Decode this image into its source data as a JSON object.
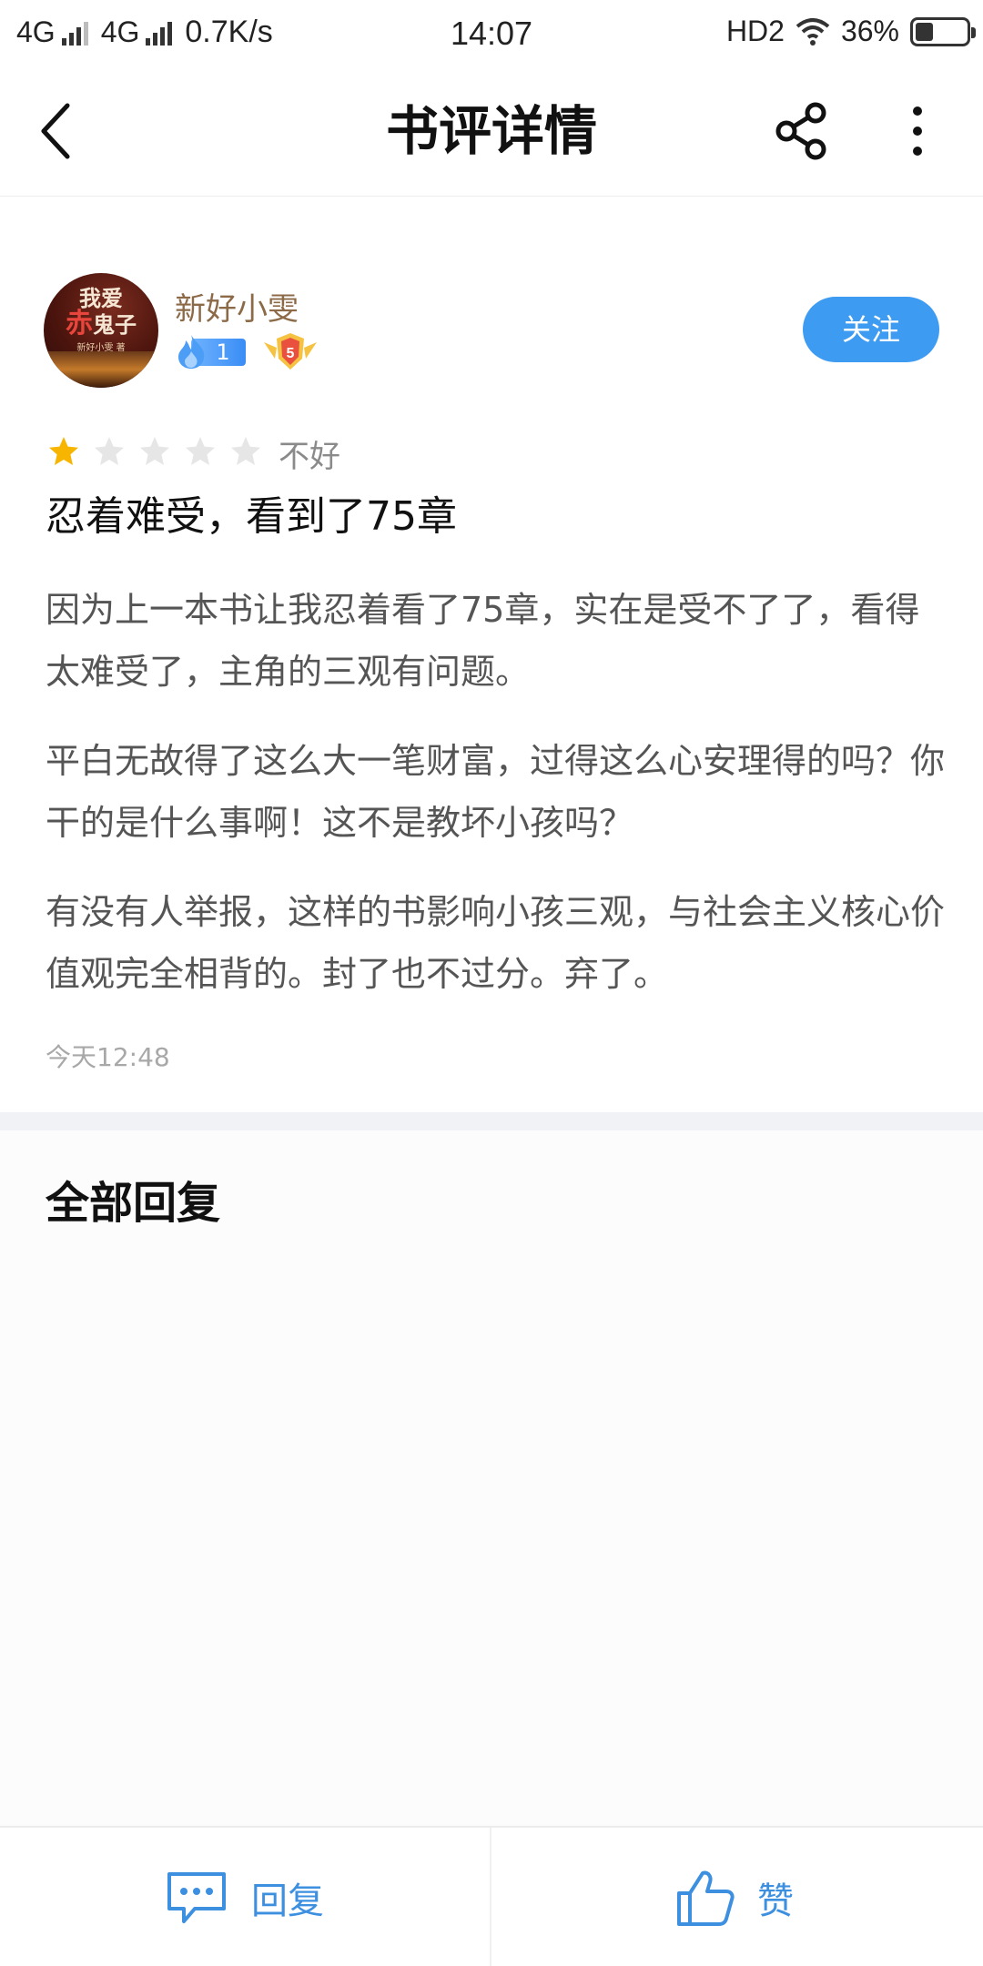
{
  "status_bar": {
    "network1": "4G",
    "network2": "4G",
    "speed": "0.7K/s",
    "time": "14:07",
    "hd": "HD2",
    "battery_percent": "36%",
    "battery_level": 0.36
  },
  "nav": {
    "title": "书评详情",
    "back_icon": "chevron-left-icon",
    "share_icon": "share-icon",
    "more_icon": "more-vertical-icon"
  },
  "review": {
    "avatar": {
      "title_line1": "我爱",
      "title_line2_red": "赤",
      "title_line2": "鬼子",
      "author_small": "新好小雯 著"
    },
    "username": "新好小雯",
    "fan_level": "1",
    "shield_level": "5",
    "follow_label": "关注",
    "rating": 1,
    "rating_max": 5,
    "rating_text": "不好",
    "title": "忍着难受，看到了75章",
    "paragraphs": [
      "因为上一本书让我忍着看了75章，实在是受不了了，看得太难受了，主角的三观有问题。",
      "平白无故得了这么大一笔财富，过得这么心安理得的吗？你干的是什么事啊！这不是教坏小孩吗？",
      "有没有人举报，这样的书影响小孩三观，与社会主义核心价值观完全相背的。封了也不过分。弃了。"
    ],
    "time": "今天12:48"
  },
  "replies": {
    "heading": "全部回复"
  },
  "bottom_bar": {
    "reply_label": "回复",
    "like_label": "赞"
  },
  "colors": {
    "accent": "#3d9bf2",
    "username": "#8c6a48",
    "star_active": "#f7b500",
    "star_inactive": "#e6e6e6"
  }
}
